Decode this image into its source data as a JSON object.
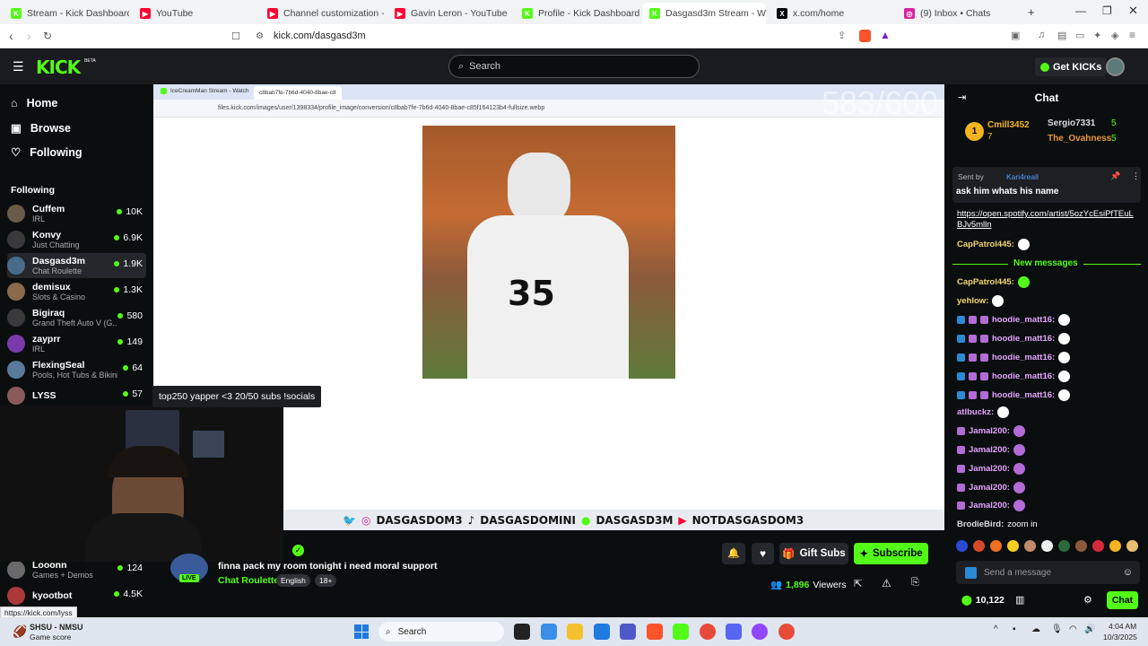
{
  "browser": {
    "tabs": [
      {
        "title": "Stream - Kick Dashboard",
        "color": "#53fc18",
        "glyph": "K"
      },
      {
        "title": "YouTube",
        "color": "#ff0033",
        "glyph": "▶"
      },
      {
        "title": "Channel customization - YouTu",
        "color": "#ff0033",
        "glyph": "▶"
      },
      {
        "title": "Gavin Leron - YouTube",
        "color": "#ff0033",
        "glyph": "▶"
      },
      {
        "title": "Profile - Kick Dashboard",
        "color": "#53fc18",
        "glyph": "K"
      },
      {
        "title": "Dasgasd3m Stream - W",
        "color": "#53fc18",
        "glyph": "K"
      },
      {
        "title": "x.com/home",
        "color": "#000000",
        "glyph": "X"
      },
      {
        "title": "(9) Inbox • Chats",
        "color": "#d6249f",
        "glyph": "◎"
      }
    ],
    "url": "kick.com/dasgasd3m",
    "status_url": "https://kick.com/lyss"
  },
  "header": {
    "logo": "KICK",
    "logo_tag": "BETA",
    "search_placeholder": "Search",
    "get_kicks": "Get KICKs"
  },
  "sidebar": {
    "nav": [
      {
        "label": "Home",
        "icon": "home-icon"
      },
      {
        "label": "Browse",
        "icon": "browse-icon"
      },
      {
        "label": "Following",
        "icon": "heart-icon"
      }
    ],
    "following_title": "Following",
    "channels": [
      {
        "name": "Cuffem",
        "category": "IRL",
        "viewers": "10K"
      },
      {
        "name": "Konvy",
        "category": "Just Chatting",
        "viewers": "6.9K"
      },
      {
        "name": "Dasgasd3m",
        "category": "Chat Roulette",
        "viewers": "1.9K"
      },
      {
        "name": "demisux",
        "category": "Slots & Casino",
        "viewers": "1.3K"
      },
      {
        "name": "Bigiraq",
        "category": "Grand Theft Auto V (G...",
        "viewers": "580"
      },
      {
        "name": "zayprr",
        "category": "IRL",
        "viewers": "149"
      },
      {
        "name": "FlexingSeal",
        "category": "Pools, Hot Tubs & Bikinis",
        "viewers": "64"
      },
      {
        "name": "LYSS",
        "category": "",
        "viewers": "57"
      },
      {
        "name": "Looonn",
        "category": "Games + Demos",
        "viewers": "124"
      },
      {
        "name": "kyootbot",
        "category": "",
        "viewers": "4.5K"
      }
    ]
  },
  "stream": {
    "inner_tabs": [
      "IceCreamMan Stream - Watch",
      "c8bab7fe-7b6d-4040-8bae-c8"
    ],
    "inner_url": "files.kick.com/images/user/1398334/profile_image/conversion/c8bab7fe-7b6d-4040-8bae-c85f164123b4-fullsize.webp",
    "overlay_number": "583/600",
    "socials": [
      "DASGASDOM3",
      "DASGASDOMINI",
      "DASGASD3M",
      "NOTDASGASDOM3"
    ],
    "tooltip": "top250 yapper <3 20/50 subs !socials",
    "title": "finna pack my room tonight i need moral support",
    "category": "Chat Roulette",
    "tags": [
      "English",
      "18+"
    ],
    "viewers": "1,896",
    "viewers_label": "Viewers",
    "live": "LIVE",
    "gift_subs": "Gift Subs",
    "subscribe": "Subscribe"
  },
  "chat": {
    "title": "Chat",
    "leaders": [
      {
        "name": "Cmill3452",
        "count": "7"
      },
      {
        "name": "Sergio7331",
        "count": "5"
      },
      {
        "name": "The_Ovahness",
        "count": "5"
      }
    ],
    "pinned_by_label": "Sent by",
    "pinned_by": "Kari4reall",
    "pinned_message": "ask him whats his name",
    "link": "https://open.spotify.com/artist/5ozYcEsiPfTEuLBJv5mlln",
    "new_messages": "New messages",
    "messages": [
      {
        "user": "CapPatrol445:",
        "color": "#f5d76e",
        "emote": "#ffffff"
      },
      {
        "user": "CapPatrol445:",
        "color": "#f5d76e",
        "emote": "#53fc18"
      },
      {
        "user": "yehlow:",
        "color": "#f5d76e",
        "emote": "#ffffff"
      },
      {
        "user": "hoodie_matt16:",
        "color": "#e6a4ff",
        "emote": "#ffffff"
      },
      {
        "user": "hoodie_matt16:",
        "color": "#e6a4ff",
        "emote": "#ffffff"
      },
      {
        "user": "hoodie_matt16:",
        "color": "#e6a4ff",
        "emote": "#ffffff"
      },
      {
        "user": "hoodie_matt16:",
        "color": "#e6a4ff",
        "emote": "#ffffff"
      },
      {
        "user": "hoodie_matt16:",
        "color": "#e6a4ff",
        "emote": "#ffffff"
      },
      {
        "user": "atlbuckz:",
        "color": "#e6a4ff",
        "emote": "#ffffff"
      },
      {
        "user": "Jamal200:",
        "color": "#e6a4ff",
        "emote": "#b36bd6"
      },
      {
        "user": "Jamal200:",
        "color": "#e6a4ff",
        "emote": "#b36bd6"
      },
      {
        "user": "Jamal200:",
        "color": "#e6a4ff",
        "emote": "#b36bd6"
      },
      {
        "user": "Jamal200:",
        "color": "#e6a4ff",
        "emote": "#b36bd6"
      },
      {
        "user": "Jamal200:",
        "color": "#e6a4ff",
        "emote": "#b36bd6"
      }
    ],
    "last_user": "BrodieBird:",
    "last_text": "zoom in",
    "send_placeholder": "Send a message",
    "points": "10,122",
    "chat_button": "Chat"
  },
  "taskbar": {
    "notif_title": "SHSU - NMSU",
    "notif_sub": "Game score",
    "search": "Search",
    "time": "4:04 AM",
    "date": "10/3/2025"
  }
}
